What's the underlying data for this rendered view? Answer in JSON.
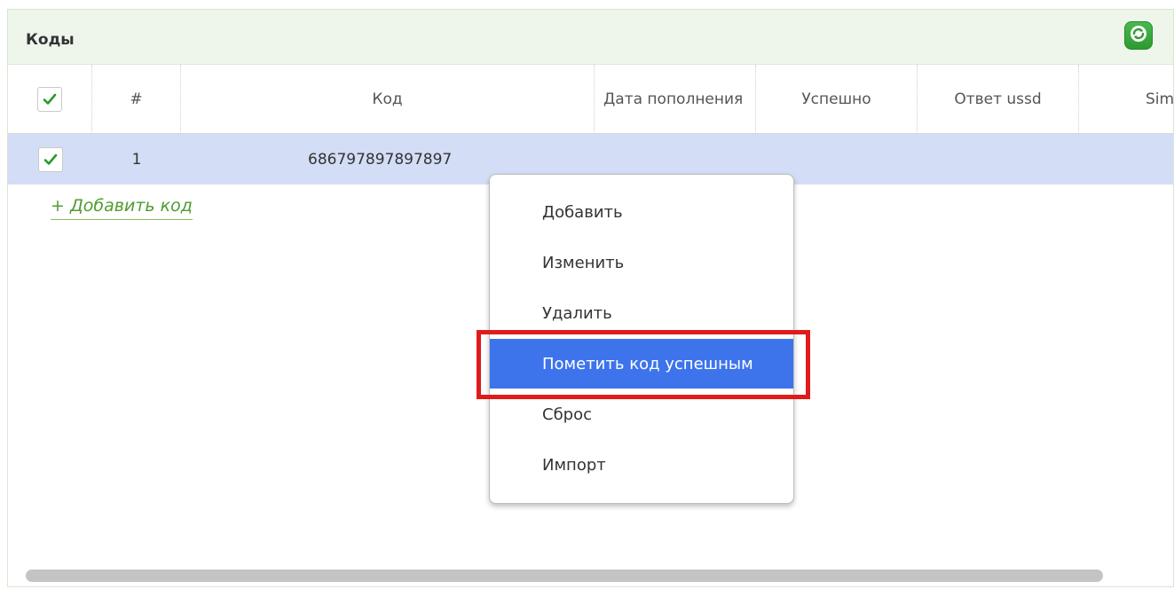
{
  "panel": {
    "title": "Коды"
  },
  "icons": {
    "refresh": "refresh-icon",
    "check": "checkmark-icon"
  },
  "colors": {
    "accent_green": "#2e9b32",
    "selected_row": "#d3ddf5",
    "menu_active": "#3d74ec",
    "highlight": "#e01b1b"
  },
  "grid": {
    "columns": [
      "#",
      "Код",
      "Дата пополнения",
      "Успешно",
      "Ответ ussd",
      "Sim"
    ],
    "rows": [
      {
        "num": "1",
        "code": "686797897897897"
      }
    ]
  },
  "add_link": "+ Добавить код",
  "context_menu": {
    "items": [
      "Добавить",
      "Изменить",
      "Удалить",
      "Пометить код успешным",
      "Сброс",
      "Импорт"
    ],
    "active_index": 3
  }
}
